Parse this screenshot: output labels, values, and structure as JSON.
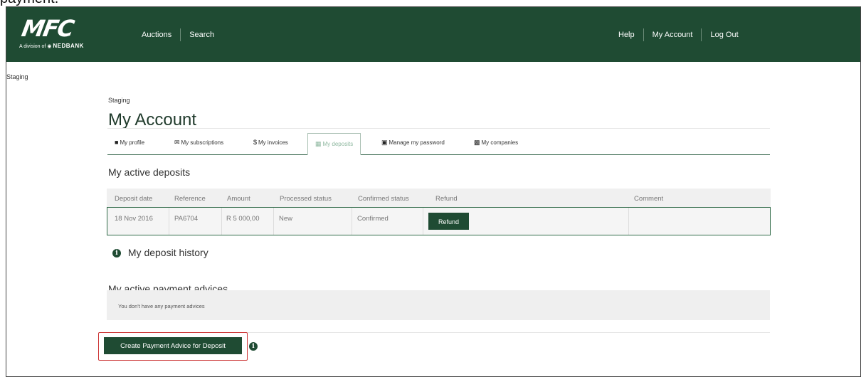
{
  "caption": "payment.",
  "header": {
    "logo_text": "MFC",
    "logo_sub_prefix": "A division of",
    "logo_sub_brand": "NEDBANK",
    "nav_left": [
      "Auctions",
      "Search"
    ],
    "nav_right": [
      "Help",
      "My Account",
      "Log Out"
    ]
  },
  "staging_corner": "Staging",
  "breadcrumb": "Staging",
  "page_title": "My Account",
  "tabs": [
    {
      "label": "My profile",
      "icon": "user-icon"
    },
    {
      "label": "My subscriptions",
      "icon": "envelope-icon"
    },
    {
      "label": "My invoices",
      "icon": "dollar-icon"
    },
    {
      "label": "My deposits",
      "icon": "money-icon",
      "active": true
    },
    {
      "label": "Manage my password",
      "icon": "lock-icon"
    },
    {
      "label": "My companies",
      "icon": "briefcase-icon"
    }
  ],
  "active_deposits": {
    "title": "My active deposits",
    "columns": [
      "Deposit date",
      "Reference",
      "Amount",
      "Processed status",
      "Confirmed status",
      "Refund",
      "Comment"
    ],
    "rows": [
      {
        "date": "18 Nov 2016",
        "reference": "PA6704",
        "amount": "R 5 000,00",
        "processed": "New",
        "confirmed": "Confirmed",
        "refund_label": "Refund",
        "comment": ""
      }
    ]
  },
  "deposit_history": {
    "title": "My deposit history"
  },
  "payment_advices": {
    "title": "My active payment advices",
    "empty_text": "You don't have any payment advices"
  },
  "create_button": "Create Payment Advice for Deposit",
  "colors": {
    "brand_green": "#1f4b33",
    "highlight_red": "#cc3333"
  }
}
